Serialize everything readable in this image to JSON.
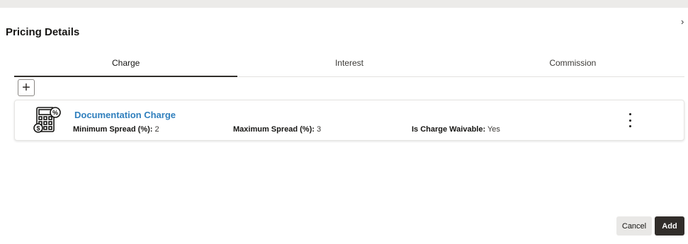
{
  "dialog": {
    "title": "Pricing Details",
    "close_glyph": "›"
  },
  "tabs": [
    {
      "label": "Charge",
      "active": true
    },
    {
      "label": "Interest",
      "active": false
    },
    {
      "label": "Commission",
      "active": false
    }
  ],
  "add_button_glyph": "+",
  "card": {
    "icon": "calculator-percent-icon",
    "title": "Documentation Charge",
    "fields": [
      {
        "label": "Minimum Spread (%):",
        "value": "2"
      },
      {
        "label": "Maximum Spread (%):",
        "value": "3"
      },
      {
        "label": "Is Charge Waivable:",
        "value": "Yes"
      }
    ],
    "menu_icon": "kebab-menu-icon"
  },
  "footer": {
    "cancel_label": "Cancel",
    "add_label": "Add"
  },
  "colors": {
    "link": "#2f7fbd",
    "primary_button": "#312d2a",
    "secondary_button": "#e9e8e6"
  }
}
